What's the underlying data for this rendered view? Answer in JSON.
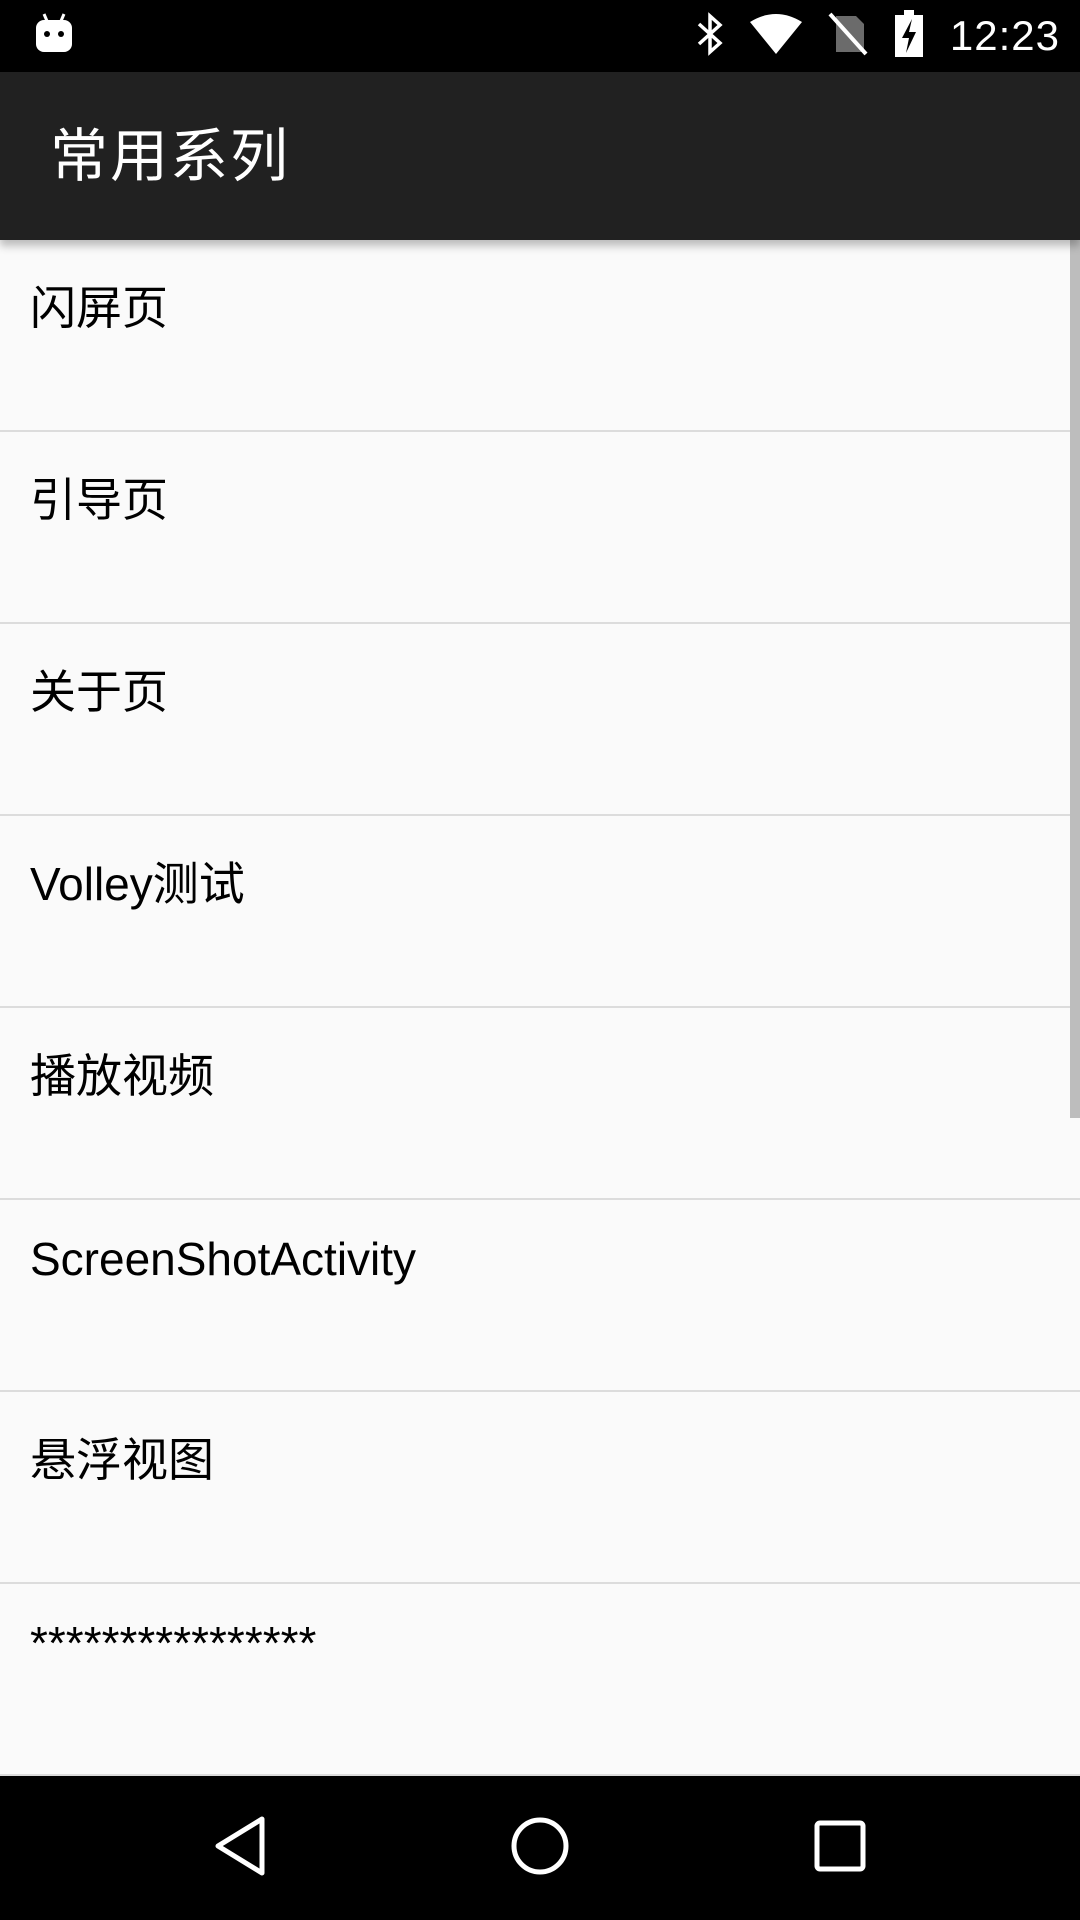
{
  "status_bar": {
    "time": "12:23",
    "icons": [
      "android-notification-icon",
      "bluetooth-icon",
      "wifi-icon",
      "no-sim-icon",
      "battery-charging-icon"
    ]
  },
  "app_bar": {
    "title": "常用系列"
  },
  "list": {
    "items": [
      {
        "label": "闪屏页"
      },
      {
        "label": "引导页"
      },
      {
        "label": "关于页"
      },
      {
        "label": "Volley测试"
      },
      {
        "label": "播放视频"
      },
      {
        "label": "ScreenShotActivity"
      },
      {
        "label": "悬浮视图"
      },
      {
        "label": "****************"
      }
    ]
  },
  "nav_bar": {
    "buttons": [
      "back-icon",
      "home-icon",
      "recents-icon"
    ]
  },
  "colors": {
    "status_bar": "#000000",
    "app_bar": "#212121",
    "background": "#fafafa",
    "divider": "#dcdcdc"
  }
}
